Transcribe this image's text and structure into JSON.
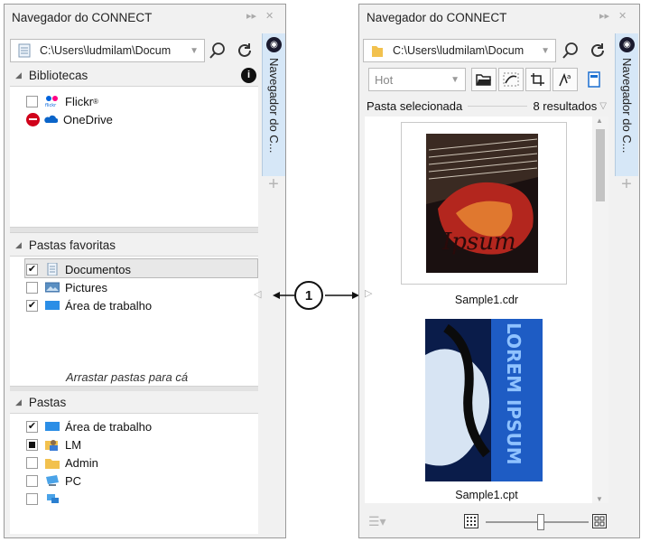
{
  "left_panel": {
    "title": "Navegador do CONNECT",
    "dock_tab_label": "Navegador do C...",
    "path": "C:\\Users\\ludmilam\\Docum",
    "sections": {
      "libraries": {
        "header": "Bibliotecas",
        "items": [
          {
            "label": "Flickr",
            "icon": "flickr-icon",
            "checked": false
          },
          {
            "label": "OneDrive",
            "icon": "onedrive-icon",
            "status": "blocked"
          }
        ]
      },
      "favorites": {
        "header": "Pastas favoritas",
        "items": [
          {
            "label": "Documentos",
            "icon": "documents-folder-icon",
            "checked": true,
            "selected": true
          },
          {
            "label": "Pictures",
            "icon": "pictures-folder-icon",
            "checked": false
          },
          {
            "label": "Área de trabalho",
            "icon": "desktop-folder-icon",
            "checked": true
          }
        ],
        "drop_hint": "Arrastar pastas para cá"
      },
      "folders": {
        "header": "Pastas",
        "items": [
          {
            "label": "Área de trabalho",
            "icon": "desktop-folder-icon",
            "state": "checked"
          },
          {
            "label": "LM",
            "icon": "user-folder-icon",
            "state": "partial"
          },
          {
            "label": "Admin",
            "icon": "folder-icon",
            "state": "unchecked"
          },
          {
            "label": "PC",
            "icon": "computer-icon",
            "state": "unchecked"
          },
          {
            "label": "",
            "icon": "network-icon",
            "state": "unchecked"
          }
        ]
      }
    }
  },
  "right_panel": {
    "title": "Navegador do CONNECT",
    "dock_tab_label": "Navegador do C...",
    "path": "C:\\Users\\ludmilam\\Docum",
    "filter": {
      "selected": "Hot"
    },
    "results_label": "Pasta selecionada",
    "results_count": "8 resultados",
    "thumbnails": [
      {
        "caption": "Sample1.cdr",
        "art_text": "Ipsum"
      },
      {
        "caption": "Sample1.cpt",
        "art_text": "LOREM IPSUM"
      }
    ]
  },
  "callout": {
    "number": "1"
  },
  "colors": {
    "dock_tab": "#d6e7f7",
    "accent": "#1a6fd1",
    "panel_bg": "#f1f1f1"
  }
}
